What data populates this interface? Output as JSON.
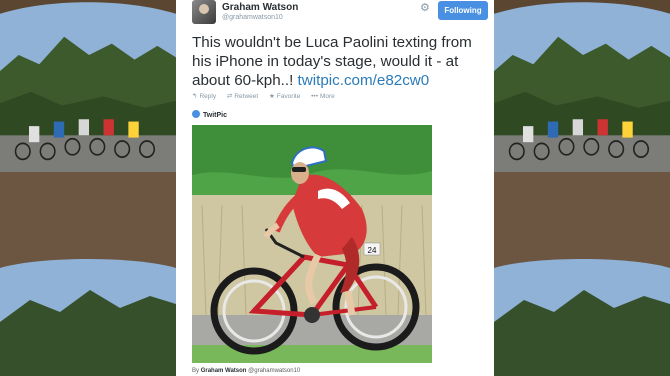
{
  "author": {
    "name": "Graham Watson",
    "handle": "@grahamwatson10"
  },
  "follow_button": "Following",
  "tweet": {
    "text": "This wouldn't be Luca Paolini texting from his iPhone in today's stage, would it - at about 60-kph..! ",
    "link": "twitpic.com/e82cw0"
  },
  "actions": {
    "reply": "Reply",
    "retweet": "Retweet",
    "favorite": "Favorite",
    "more": "More"
  },
  "media": {
    "source": "TwitPic",
    "rider_number": "24"
  },
  "credit": {
    "prefix": "By",
    "name": "Graham Watson",
    "handle": "@grahamwatson10"
  },
  "icons": {
    "settings": "gear-icon",
    "reply": "reply-icon",
    "retweet": "retweet-icon",
    "favorite": "star-icon",
    "more": "more-icon",
    "twitpic": "twitpic-icon"
  },
  "colors": {
    "follow_button": "#4a90e2",
    "link": "#2b7bb9",
    "jersey": "#d63a3a"
  }
}
